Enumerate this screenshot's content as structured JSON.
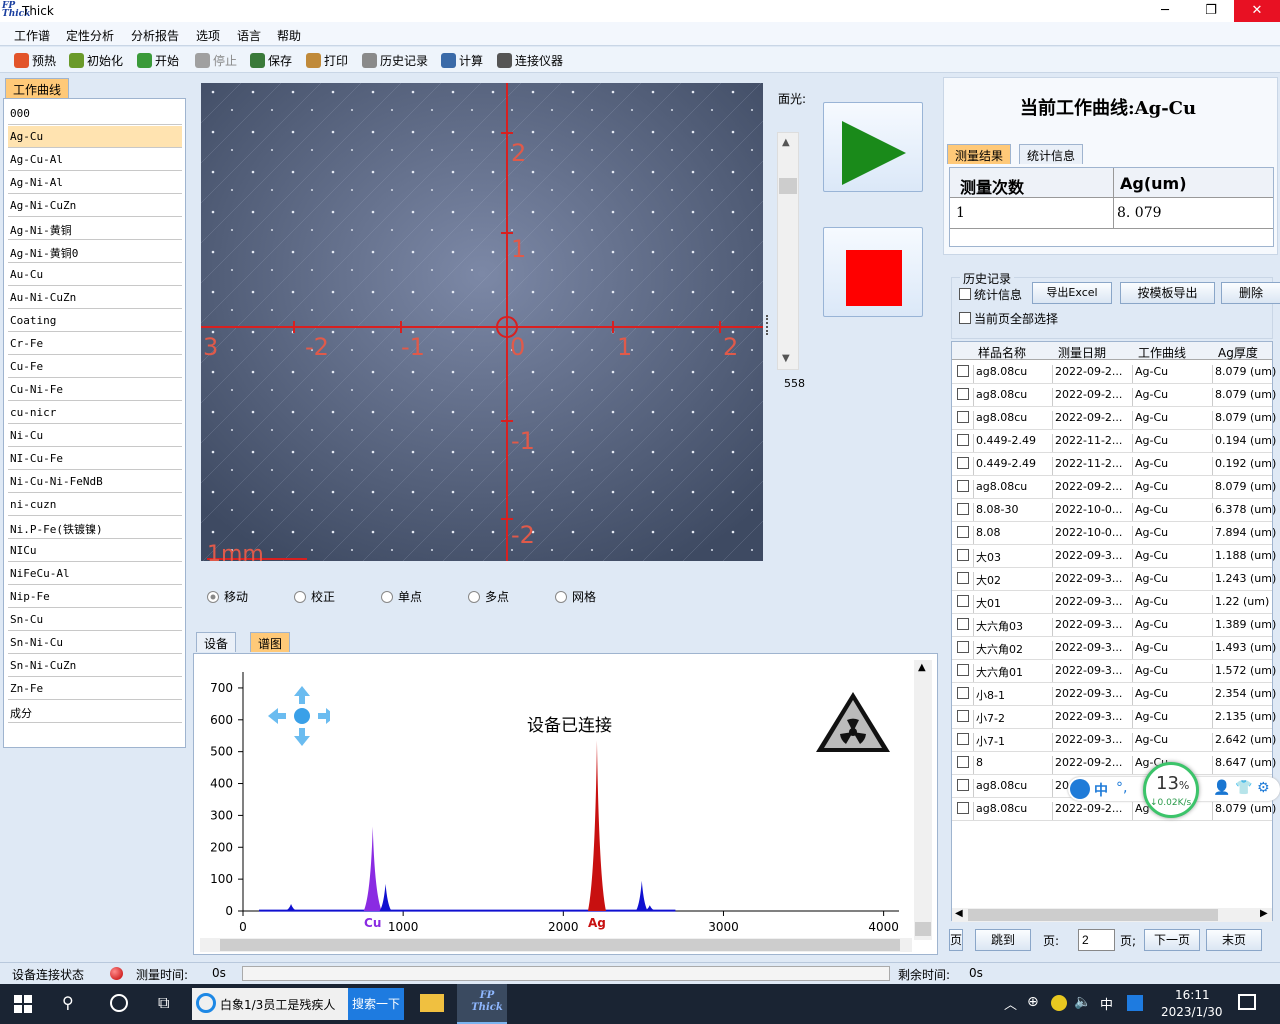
{
  "app": {
    "title": "Thick",
    "logo_text": "FP Thick"
  },
  "window": {
    "minimize": "─",
    "restore": "❐",
    "close": "✕"
  },
  "menu": [
    "工作谱",
    "定性分析",
    "分析报告",
    "选项",
    "语言",
    "帮助"
  ],
  "toolbar": [
    {
      "label": "预热",
      "icon": "flame-icon",
      "color": "#e2542a"
    },
    {
      "label": "初始化",
      "icon": "gear-init-icon",
      "color": "#6a9a2a"
    },
    {
      "label": "开始",
      "icon": "play-icon",
      "color": "#3a9a3a"
    },
    {
      "label": "停止",
      "icon": "stop-icon",
      "color": "#a0a0a0",
      "disabled": true
    },
    {
      "label": "保存",
      "icon": "save-icon",
      "color": "#3a7a3a"
    },
    {
      "label": "打印",
      "icon": "print-icon",
      "color": "#c08a3a"
    },
    {
      "label": "历史记录",
      "icon": "history-icon",
      "color": "#8a8a8a"
    },
    {
      "label": "计算",
      "icon": "calculator-icon",
      "color": "#3a6aa8"
    },
    {
      "label": "连接仪器",
      "icon": "connect-icon",
      "color": "#555555"
    }
  ],
  "left": {
    "tab": "工作曲线",
    "curves": [
      "000",
      "Ag-Cu",
      "Ag-Cu-Al",
      "Ag-Ni-Al",
      "Ag-Ni-CuZn",
      "Ag-Ni-黄铜",
      "Ag-Ni-黄铜0",
      "Au-Cu",
      "Au-Ni-CuZn",
      "Coating",
      "Cr-Fe",
      "Cu-Fe",
      "Cu-Ni-Fe",
      "cu-nicr",
      "Ni-Cu",
      "NI-Cu-Fe",
      "Ni-Cu-Ni-FeNdB",
      "ni-cuzn",
      "Ni.P-Fe(铁镀镍)",
      "NICu",
      "NiFeCu-Al",
      "Nip-Fe",
      "Sn-Cu",
      "Sn-Ni-Cu",
      "Sn-Ni-CuZn",
      "Zn-Fe",
      "成分"
    ],
    "selected": 1
  },
  "camera": {
    "x_ticks": [
      "3",
      "-2",
      "-1",
      "0",
      "1",
      "2"
    ],
    "y_ticks": [
      "2",
      "1",
      "-1",
      "-2"
    ],
    "scale_label": "1mm",
    "light_label": "面光:",
    "slider_value": "558"
  },
  "modes": [
    {
      "label": "移动",
      "on": true
    },
    {
      "label": "校正",
      "on": false
    },
    {
      "label": "单点",
      "on": false
    },
    {
      "label": "多点",
      "on": false
    },
    {
      "label": "网格",
      "on": false
    }
  ],
  "bottom_tabs": [
    "设备",
    "谱图"
  ],
  "spectrum": {
    "status": "设备已连接",
    "element_labels": [
      "Cu",
      "Ag"
    ]
  },
  "chart_data": {
    "type": "line",
    "xlim": [
      0,
      4096
    ],
    "ylim": [
      0,
      750
    ],
    "xticks": [
      0,
      1000,
      2000,
      3000,
      4000
    ],
    "yticks": [
      0,
      100,
      200,
      300,
      400,
      500,
      600,
      700
    ],
    "peaks": [
      {
        "x": 300,
        "y": 22,
        "color": "#1010d0"
      },
      {
        "x": 810,
        "y": 265,
        "color": "#8a2be2",
        "label": "Cu"
      },
      {
        "x": 890,
        "y": 85,
        "color": "#1010d0"
      },
      {
        "x": 2210,
        "y": 535,
        "color": "#c81010",
        "label": "Ag"
      },
      {
        "x": 2490,
        "y": 95,
        "color": "#1010d0"
      },
      {
        "x": 2540,
        "y": 18,
        "color": "#1010d0"
      }
    ]
  },
  "current_curve": "当前工作曲线:Ag-Cu",
  "result_tabs": [
    "测量结果",
    "统计信息"
  ],
  "result": {
    "headers": [
      "测量次数",
      "Ag(um)"
    ],
    "rows": [
      [
        "1",
        "8. 079"
      ]
    ]
  },
  "history": {
    "group": "历史记录",
    "stat_check": "统计信息",
    "select_all": "当前页全部选择",
    "export_excel": "导出Excel",
    "export_template": "按模板导出",
    "delete": "删除",
    "headers": [
      "样品名称",
      "测量日期",
      "工作曲线",
      "Ag厚度"
    ],
    "rows": [
      [
        "ag8.08cu",
        "2022-09-2...",
        "Ag-Cu",
        "8.079 (um)"
      ],
      [
        "ag8.08cu",
        "2022-09-2...",
        "Ag-Cu",
        "8.079 (um)"
      ],
      [
        "ag8.08cu",
        "2022-09-2...",
        "Ag-Cu",
        "8.079 (um)"
      ],
      [
        "0.449-2.49",
        "2022-11-2...",
        "Ag-Cu",
        "0.194 (um)"
      ],
      [
        "0.449-2.49",
        "2022-11-2...",
        "Ag-Cu",
        "0.192 (um)"
      ],
      [
        "ag8.08cu",
        "2022-09-2...",
        "Ag-Cu",
        "8.079 (um)"
      ],
      [
        "8.08-30",
        "2022-10-0...",
        "Ag-Cu",
        "6.378 (um)"
      ],
      [
        "8.08",
        "2022-10-0...",
        "Ag-Cu",
        "7.894 (um)"
      ],
      [
        "大03",
        "2022-09-3...",
        "Ag-Cu",
        "1.188 (um)"
      ],
      [
        "大02",
        "2022-09-3...",
        "Ag-Cu",
        "1.243 (um)"
      ],
      [
        "大01",
        "2022-09-3...",
        "Ag-Cu",
        "1.22 (um)"
      ],
      [
        "大六角03",
        "2022-09-3...",
        "Ag-Cu",
        "1.389 (um)"
      ],
      [
        "大六角02",
        "2022-09-3...",
        "Ag-Cu",
        "1.493 (um)"
      ],
      [
        "大六角01",
        "2022-09-3...",
        "Ag-Cu",
        "1.572 (um)"
      ],
      [
        "小8-1",
        "2022-09-3...",
        "Ag-Cu",
        "2.354 (um)"
      ],
      [
        "小7-2",
        "2022-09-3...",
        "Ag-Cu",
        "2.135 (um)"
      ],
      [
        "小7-1",
        "2022-09-3...",
        "Ag-Cu",
        "2.642 (um)"
      ],
      [
        "8",
        "2022-09-2...",
        "Ag-Cu",
        "8.647 (um)"
      ],
      [
        "ag8.08cu",
        "20",
        "",
        "(um)"
      ],
      [
        "ag8.08cu",
        "2022-09-2...",
        "Ag",
        "8.079 (um)"
      ]
    ],
    "pager": {
      "page_prefix": "页",
      "jump": "跳到",
      "page_label": "页:",
      "page_value": "2",
      "page_suffix": "页;",
      "next": "下一页",
      "last": "末页",
      "ye": "页"
    }
  },
  "widget": {
    "percent": "13",
    "unit": "%",
    "speed": "↓0.02K/s",
    "ime": "中"
  },
  "status": {
    "connect_label": "设备连接状态",
    "time_label": "测量时间:",
    "time_value": "0s",
    "remain_label": "剩余时间:",
    "remain_value": "0s"
  },
  "taskbar": {
    "tab_text": "白象1/3员工是残疾人",
    "search_btn": "搜索一下",
    "app_label": "FP Thick",
    "time": "16:11",
    "date": "2023/1/30",
    "ime": "中"
  }
}
